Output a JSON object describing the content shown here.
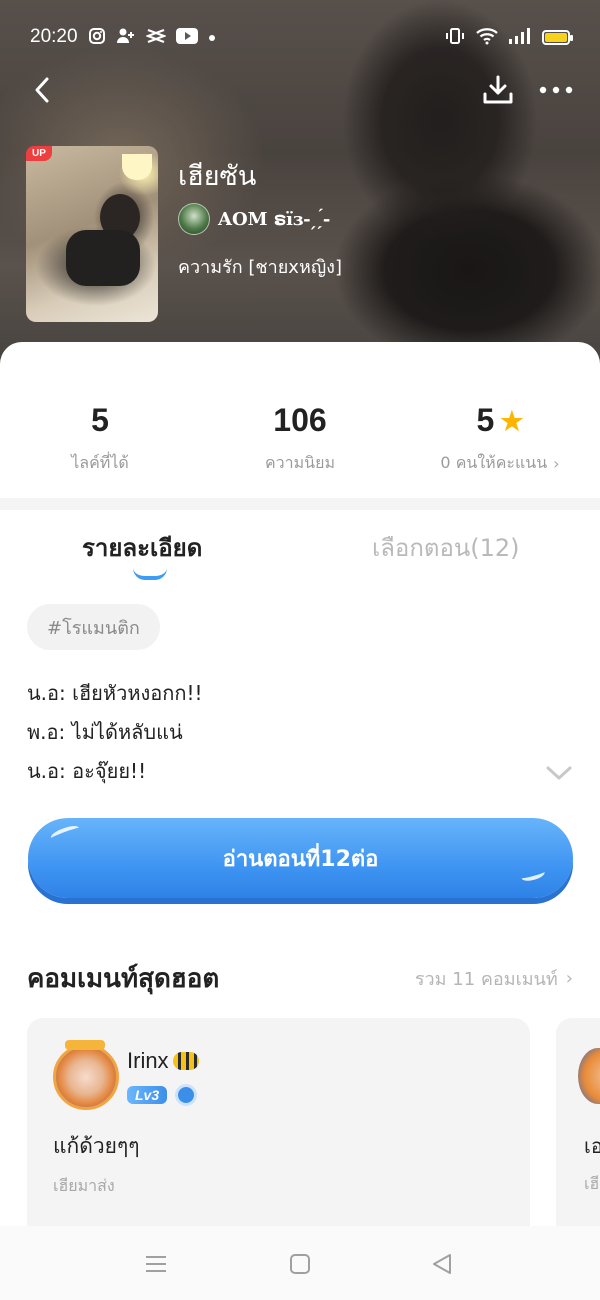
{
  "status_bar": {
    "time": "20:20",
    "left_icons": [
      "instagram-icon",
      "add-user-icon",
      "capcut-icon",
      "youtube-icon",
      "dot-icon"
    ],
    "right_icons": [
      "vibrate-icon",
      "wifi-icon",
      "signal-icon",
      "battery-icon"
    ],
    "battery_color": "#f7d21a"
  },
  "header": {
    "back_icon": "chevron-left-icon",
    "download_icon": "download-icon",
    "more_icon": "more-dots-icon",
    "cover_badge": "UP",
    "title": "เฮียซัน",
    "author": "AOM ຣïɜ- ̗ˏ́-",
    "genre": "ความรัก [ชายxหญิง]"
  },
  "stats": [
    {
      "value": "5",
      "label": "ไลค์ที่ได้"
    },
    {
      "value": "106",
      "label": "ความนิยม"
    },
    {
      "value": "5",
      "label": "0 คนให้คะแนน",
      "icon": "star-icon"
    }
  ],
  "tabs": {
    "details": "รายละเอียด",
    "episodes": "เลือกตอน(12)",
    "active": "details"
  },
  "tag": "#โรแมนติก",
  "synopsis": [
    "น.อ: เฮียหัวหงอกก!!",
    "พ.อ: ไม่ได้หลับแน่",
    "น.อ: อะจุ๊ยย!!"
  ],
  "read_button": "อ่านตอนที่12ต่อ",
  "comments": {
    "title": "คอมเมนท์สุดฮอต",
    "total": "รวม 11 คอมเมนท์",
    "items": [
      {
        "user": "Irinx",
        "level": "Lv3",
        "text": "แก้ด้วยๆๆ",
        "episode": "เฮียมาส่ง"
      },
      {
        "text": "เอ",
        "episode": "เฮี"
      }
    ]
  },
  "colors": {
    "accent": "#3d9cf5",
    "star": "#ffb400",
    "badge": "#ee3f40"
  }
}
